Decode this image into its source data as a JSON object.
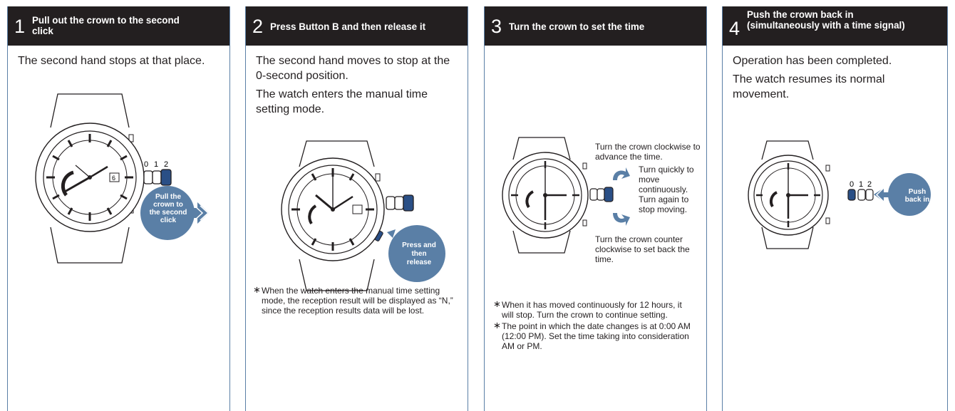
{
  "colors": {
    "header_bg": "#231f20",
    "accent": "#5a7fa6",
    "crown": "#2a4f86"
  },
  "panels": [
    {
      "number": "1",
      "title": "Pull out the crown to the second click",
      "body": [
        "The second hand stops at that place."
      ],
      "callout": "Pull the crown to the second click",
      "positions": [
        "0",
        "1",
        "2"
      ],
      "date_window": "6"
    },
    {
      "number": "2",
      "title": "Press Button B and then release it",
      "body": [
        "The second hand moves to stop at the 0-second position.",
        "The watch enters the manual time setting mode."
      ],
      "callout": "Press and then release",
      "note": "When the watch enters the manual time setting mode, the reception result will be displayed as “N,” since the reception results data will be lost."
    },
    {
      "number": "3",
      "title": "Turn the crown to set the time",
      "cw_text": "Turn the crown clockwise to advance the time.",
      "quick_text": "Turn quickly to move continuously. Turn again to stop moving.",
      "ccw_text": "Turn the crown counter clockwise to set back the time.",
      "notes": [
        "When it has moved continuously for 12 hours, it will stop. Turn the crown to continue setting.",
        "The point in which the date changes is at 0:00 AM (12:00 PM). Set the time taking into consideration AM or PM."
      ]
    },
    {
      "number": "4",
      "title": "Push the crown back in (simultaneously with a time signal)",
      "body": [
        "Operation has been completed.",
        "The watch resumes its normal movement."
      ],
      "callout": "Push back in",
      "positions": [
        "0",
        "1",
        "2"
      ]
    }
  ]
}
